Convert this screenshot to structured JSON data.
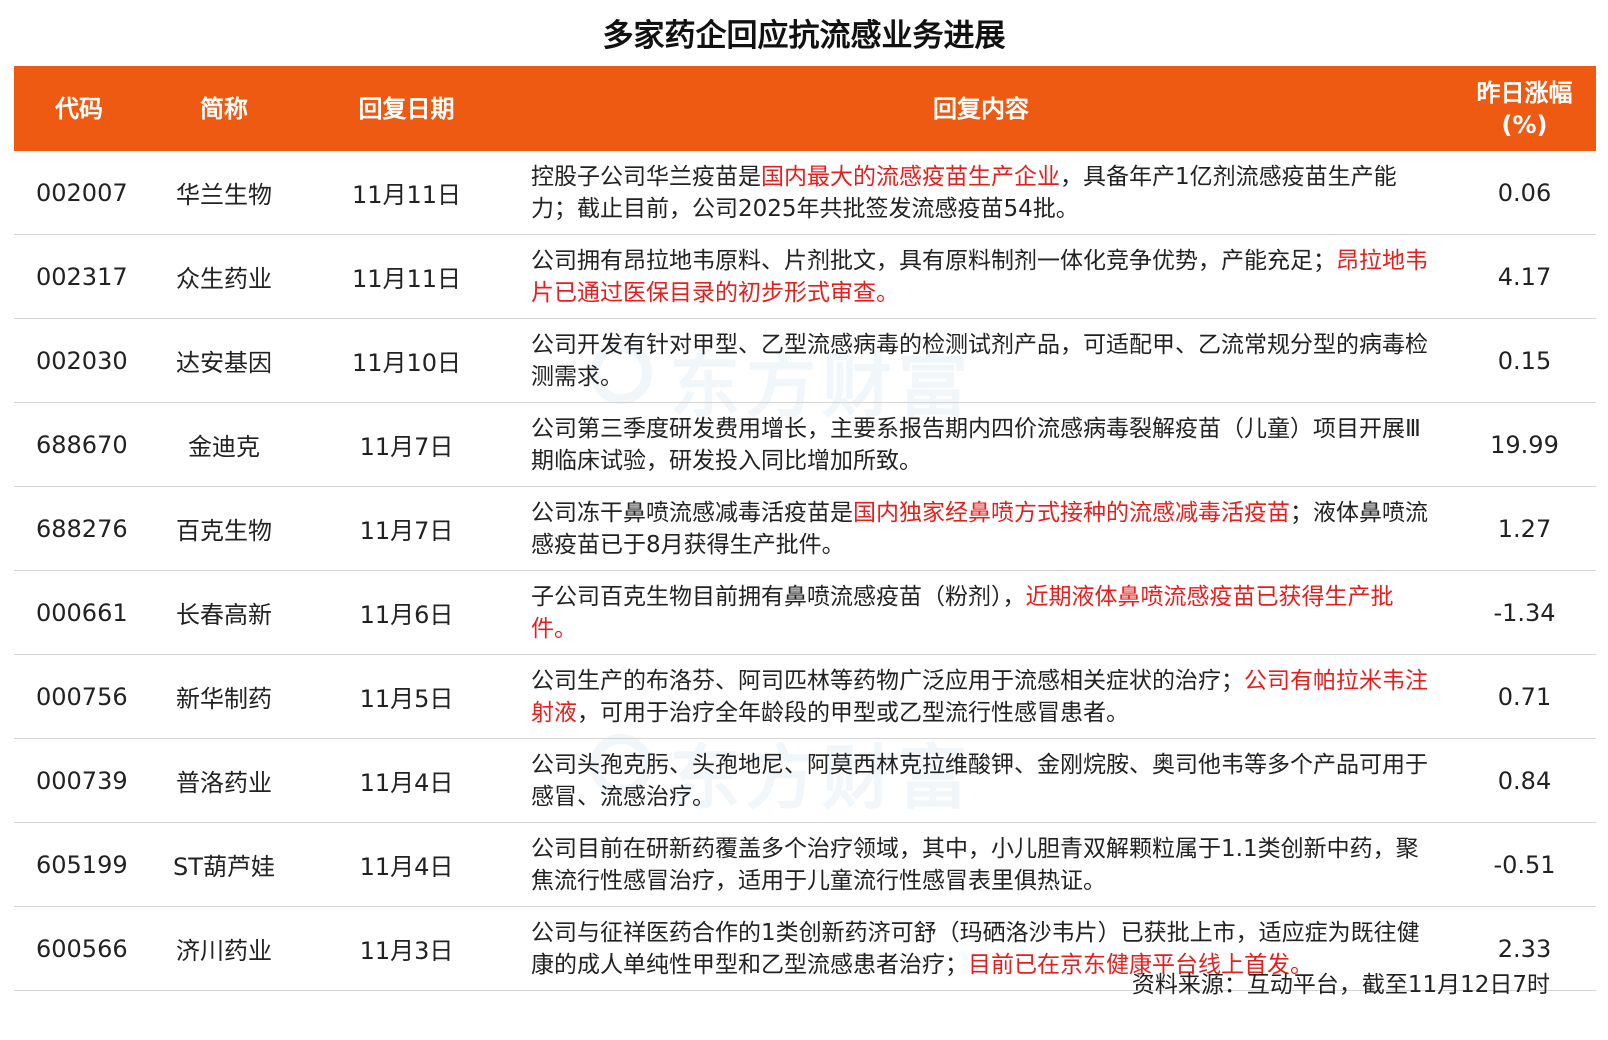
{
  "title": "多家药企回应抗流感业务进展",
  "headers": {
    "code": "代码",
    "name": "简称",
    "date": "回复日期",
    "content": "回复内容",
    "change": "昨日涨幅\n(%)"
  },
  "rows": [
    {
      "code": "002007",
      "name": "华兰生物",
      "date": "11月11日",
      "content": [
        {
          "text": "控股子公司华兰疫苗是",
          "hl": false
        },
        {
          "text": "国内最大的流感疫苗生产企业",
          "hl": true
        },
        {
          "text": "，具备年产1亿剂流感疫苗生产能力；截止目前，公司2025年共批签发流感疫苗54批。",
          "hl": false
        }
      ],
      "change": "0.06"
    },
    {
      "code": "002317",
      "name": "众生药业",
      "date": "11月11日",
      "content": [
        {
          "text": "公司拥有昂拉地韦原料、片剂批文，具有原料制剂一体化竞争优势，产能充足；",
          "hl": false
        },
        {
          "text": "昂拉地韦片已通过医保目录的初步形式审查。",
          "hl": true
        }
      ],
      "change": "4.17"
    },
    {
      "code": "002030",
      "name": "达安基因",
      "date": "11月10日",
      "content": [
        {
          "text": "公司开发有针对甲型、乙型流感病毒的检测试剂产品，可适配甲、乙流常规分型的病毒检测需求。",
          "hl": false
        }
      ],
      "change": "0.15"
    },
    {
      "code": "688670",
      "name": "金迪克",
      "date": "11月7日",
      "content": [
        {
          "text": "公司第三季度研发费用增长，主要系报告期内四价流感病毒裂解疫苗（儿童）项目开展Ⅲ期临床试验，研发投入同比增加所致。",
          "hl": false
        }
      ],
      "change": "19.99"
    },
    {
      "code": "688276",
      "name": "百克生物",
      "date": "11月7日",
      "content": [
        {
          "text": "公司冻干鼻喷流感减毒活疫苗是",
          "hl": false
        },
        {
          "text": "国内独家经鼻喷方式接种的流感减毒活疫苗",
          "hl": true
        },
        {
          "text": "；液体鼻喷流感疫苗已于8月获得生产批件。",
          "hl": false
        }
      ],
      "change": "1.27"
    },
    {
      "code": "000661",
      "name": "长春高新",
      "date": "11月6日",
      "content": [
        {
          "text": "子公司百克生物目前拥有鼻喷流感疫苗（粉剂），",
          "hl": false
        },
        {
          "text": "近期液体鼻喷流感疫苗已获得生产批件。",
          "hl": true
        }
      ],
      "change": "-1.34"
    },
    {
      "code": "000756",
      "name": "新华制药",
      "date": "11月5日",
      "content": [
        {
          "text": "公司生产的布洛芬、阿司匹林等药物广泛应用于流感相关症状的治疗；",
          "hl": false
        },
        {
          "text": "公司有帕拉米韦注射液",
          "hl": true
        },
        {
          "text": "，可用于治疗全年龄段的甲型或乙型流行性感冒患者。",
          "hl": false
        }
      ],
      "change": "0.71"
    },
    {
      "code": "000739",
      "name": "普洛药业",
      "date": "11月4日",
      "content": [
        {
          "text": "公司头孢克肟、头孢地尼、阿莫西林克拉维酸钾、金刚烷胺、奥司他韦等多个产品可用于感冒、流感治疗。",
          "hl": false
        }
      ],
      "change": "0.84"
    },
    {
      "code": "605199",
      "name": "ST葫芦娃",
      "date": "11月4日",
      "content": [
        {
          "text": "公司目前在研新药覆盖多个治疗领域，其中，小儿胆青双解颗粒属于1.1类创新中药，聚焦流行性感冒治疗，适用于儿童流行性感冒表里俱热证。",
          "hl": false
        }
      ],
      "change": "-0.51"
    },
    {
      "code": "600566",
      "name": "济川药业",
      "date": "11月3日",
      "content": [
        {
          "text": "公司与征祥医药合作的1类创新药济可舒（玛硒洛沙韦片）已获批上市，适应症为既往健康的成人单纯性甲型和乙型流感患者治疗；",
          "hl": false
        },
        {
          "text": "目前已在京东健康平台线上首发。",
          "hl": true
        }
      ],
      "change": "2.33"
    }
  ],
  "source": "资料来源：互动平台，截至11月12日7时",
  "watermark_text": "东方财富",
  "colors": {
    "header_bg": "#ee5a12",
    "highlight": "#e4201f"
  }
}
